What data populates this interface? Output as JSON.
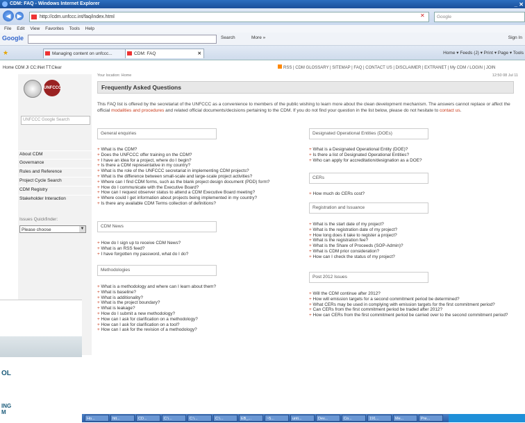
{
  "window": {
    "title": "CDM: FAQ - Windows Internet Explorer",
    "controls": "_ ✕"
  },
  "browser": {
    "url": "http://cdm.unfccc.int/faq/index.html",
    "search_placeholder": "Google",
    "menu": [
      "File",
      "Edit",
      "View",
      "Favorites",
      "Tools",
      "Help"
    ],
    "google_toolbar": {
      "logo": "Google",
      "search_label": "Search",
      "more_label": "More »",
      "signin": "Sign In"
    },
    "tabs": [
      "Managing content on unfccc...",
      "CDM: FAQ"
    ],
    "command_bar": "Home ▾  Feeds (J) ▾  Print ▾  Page ▾  Tools"
  },
  "page": {
    "bookmarks_strip": "Home CDM JI CC:iNet TT:Clear",
    "top_links": "RSS | CDM GLOSSARY | SITEMAP | FAQ | CONTACT US | DISCLAIMER | EXTRANET | My CDM / LOGIN | JOIN",
    "sidebar": {
      "logo_text": "UNFCCC",
      "search_placeholder": "UNFCCC Google Search",
      "items": [
        "About CDM",
        "Governance",
        "Rules and Reference",
        "Project Cycle Search",
        "CDM Registry",
        "Stakeholder Interaction"
      ],
      "quickfinder_label": "Issues Quickfinder:",
      "quickfinder_value": "Please choose"
    },
    "your_location": "Your location: Home",
    "datetime": "12:50 08 Jul 11",
    "title": "Frequently Asked Questions",
    "intro_1": "This FAQ list is offered by the secretariat of the UNFCCC as a convenience to members of the public wishing to learn more about the clean development mechanism. The answers cannot replace or affect the official ",
    "intro_link_1": "modalities and procedures",
    "intro_2": " and related official documents/decisions pertaining to the CDM. If you do not find your question in the list below, please do not hesitate to ",
    "intro_link_2": "contact us",
    "intro_3": ".",
    "sections": {
      "general": {
        "title": "General enquiries",
        "items": [
          "What is the CDM?",
          "Does the UNFCCC offer training on the CDM?",
          "I have an idea for a project, where do I begin?",
          "Is there a CDM representative in my country?",
          "What is the role of the UNFCCC secretariat in implementing CDM projects?",
          "What is the difference between small-scale and large-scale project activities?",
          "Where can I find CDM forms, such as the blank project design document (PDD) form?",
          "How do I communicate with the Executive Board?",
          "How can I request observer status to attend a CDM Executive Board meeting?",
          "Where could I get information about projects being implemented in my country?",
          "Is there any available CDM Terms collection of definitions?"
        ]
      },
      "news": {
        "title": "CDM News",
        "items": [
          "How do I sign up to receive CDM News?",
          "What is an RSS feed?",
          "I have forgotten my password, what do I do?"
        ]
      },
      "methodologies": {
        "title": "Methodologies",
        "items": [
          "What is a methodology and where can I learn about them?",
          "What is baseline?",
          "What is additionality?",
          "What is the project boundary?",
          "What is leakage?",
          "How do I submit a new methodology?",
          "How can I ask for clarification on a methodology?",
          "How can I ask for clarification on a tool?",
          "How can I ask for the revision of a methodology?"
        ]
      },
      "doe": {
        "title": "Designated Operational Entities (DOEs)",
        "items": [
          "What is a Designated Operational Entity (DOE)?",
          "Is there a list of Designated Operational Entities?",
          "Who can apply for accreditation/designation as a DOE?"
        ]
      },
      "cers": {
        "title": "CERs",
        "items": [
          "How much do CERs cost?"
        ]
      },
      "registration": {
        "title": "Registration and Issuance",
        "items": [
          "What is the start date of my project?",
          "What is the registration date of my project?",
          "How long does it take to register a project?",
          "What is the registration fee?",
          "What is the Share of Proceeds (SOP-Admin)?",
          "What is CDM prior consideration?",
          "How can I check the status of my project?"
        ]
      },
      "post2012": {
        "title": "Post 2012 Issues",
        "items": [
          "Will the CDM continue after 2012?",
          "How will emission targets for a second commitment period be determined?",
          "What CERs may be used in complying with emission targets for the first commitment period?",
          "Can CERs from the first commitment period be traded after 2012?",
          "How can CERs from the first commitment period be carried over to the second commitment period?"
        ]
      }
    }
  },
  "overlay_window": {
    "text_1": "OL",
    "text_2": "ING\nM"
  },
  "taskbar": {
    "items": [
      "Ho...",
      "htt...",
      "CD...",
      "C:\\...",
      "C:\\...",
      "C:\\...",
      "EB_...",
      "~5...",
      "unti...",
      "Dev...",
      "Co...",
      "191...",
      "Me...",
      "Pre..."
    ]
  }
}
